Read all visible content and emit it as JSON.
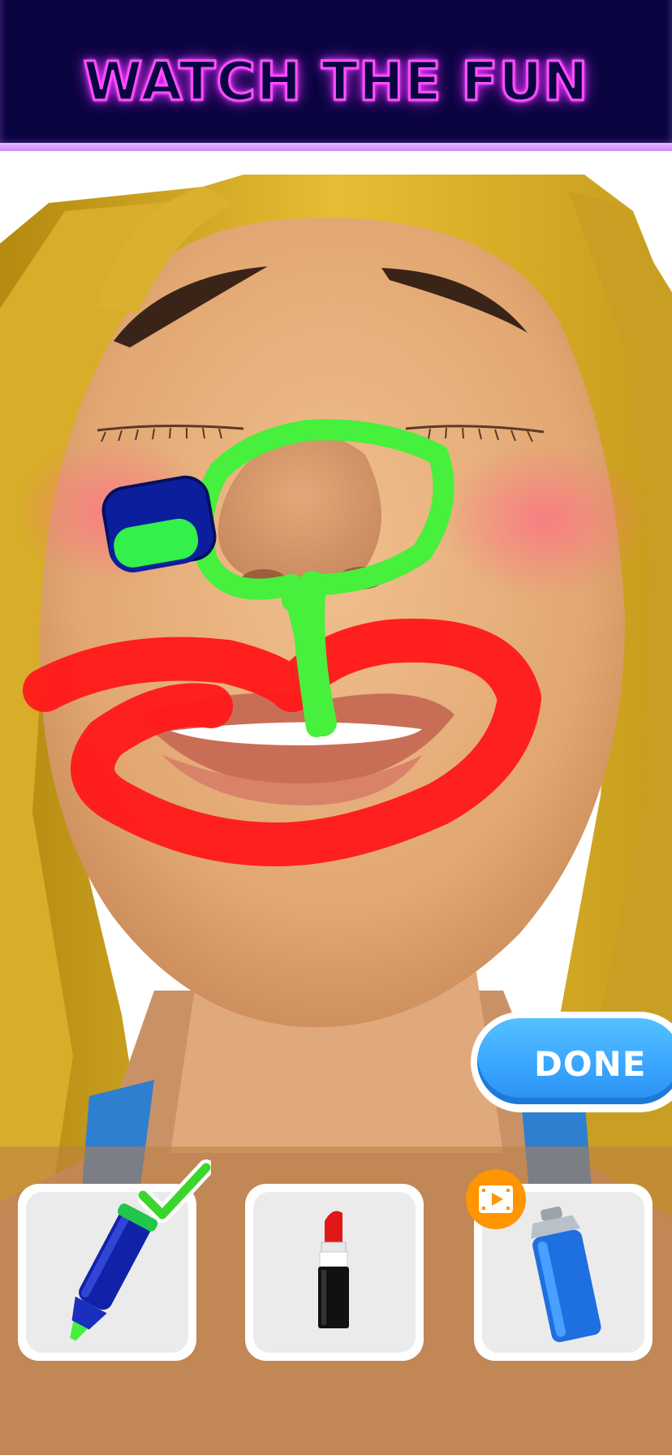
{
  "banner": {
    "title": "WATCH THE FUN"
  },
  "done_button": {
    "label": "DONE"
  },
  "tools": [
    {
      "id": "marker",
      "selected": true,
      "locked_by_video": false
    },
    {
      "id": "lipstick",
      "selected": false,
      "locked_by_video": false
    },
    {
      "id": "spray-can",
      "selected": false,
      "locked_by_video": true
    }
  ],
  "colors": {
    "banner_bg": "#0a0440",
    "banner_glow": "#ff4dff",
    "done_button": "#3aa6ff",
    "marker_color": "#46f03c",
    "lipstick_paint": "#ff1a1a",
    "video_badge": "#ff9500"
  },
  "icons": [
    "marker-icon",
    "lipstick-icon",
    "spray-can-icon",
    "checkmark-icon",
    "video-ad-icon"
  ]
}
